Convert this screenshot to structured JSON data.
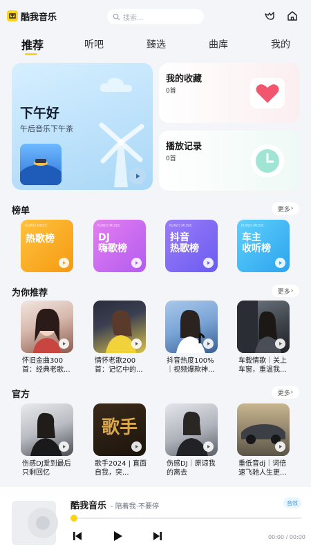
{
  "app": {
    "name": "酷我音乐"
  },
  "search": {
    "placeholder": "搜索..."
  },
  "tabs": [
    {
      "label": "推荐",
      "active": true
    },
    {
      "label": "听吧"
    },
    {
      "label": "臻选"
    },
    {
      "label": "曲库"
    },
    {
      "label": "我的"
    }
  ],
  "hero": {
    "title": "下午好",
    "subtitle": "午后音乐下午茶"
  },
  "favorites": {
    "title": "我的收藏",
    "count": "0首"
  },
  "history": {
    "title": "播放记录",
    "count": "0首"
  },
  "sections": {
    "charts": {
      "title": "榜单",
      "more": "更多"
    },
    "recommend": {
      "title": "为你推荐",
      "more": "更多"
    },
    "official": {
      "title": "官方",
      "more": "更多"
    }
  },
  "charts": [
    {
      "tag": "KUWO MUSIC",
      "name": "热歌榜",
      "color": "#f7a11a"
    },
    {
      "tag": "KUWO MUSIC",
      "name": "DJ\n嗨歌榜",
      "color": "#c96cf0"
    },
    {
      "tag": "KUWO MUSIC",
      "name": "抖音\n热歌榜",
      "color": "#7c6cf5"
    },
    {
      "tag": "KUWO MUSIC",
      "name": "车主\n收听榜",
      "color": "#3fb8f5"
    }
  ],
  "recommend": [
    {
      "name": "怀旧金曲300首：经典老歌..."
    },
    {
      "name": "情怀老歌200首：记忆中的..."
    },
    {
      "name": "抖音热度100%｜视频爆款神..."
    },
    {
      "name": "车载情歌｜关上车窗，重温我..."
    }
  ],
  "official": [
    {
      "name": "伤感DJ爱到最后只剩回忆"
    },
    {
      "name": "歌手2024 | 直面自我，突...",
      "cover_text": "歌手"
    },
    {
      "name": "伤感DJ｜原谅我的离去"
    },
    {
      "name": "重低音dj｜词倍速飞驰人生更..."
    }
  ],
  "player": {
    "title": "酷我音乐",
    "subtitle": "- 陪着我·不要停",
    "badge": "音效",
    "time": "00:00 / 00:00",
    "progress": 0
  }
}
